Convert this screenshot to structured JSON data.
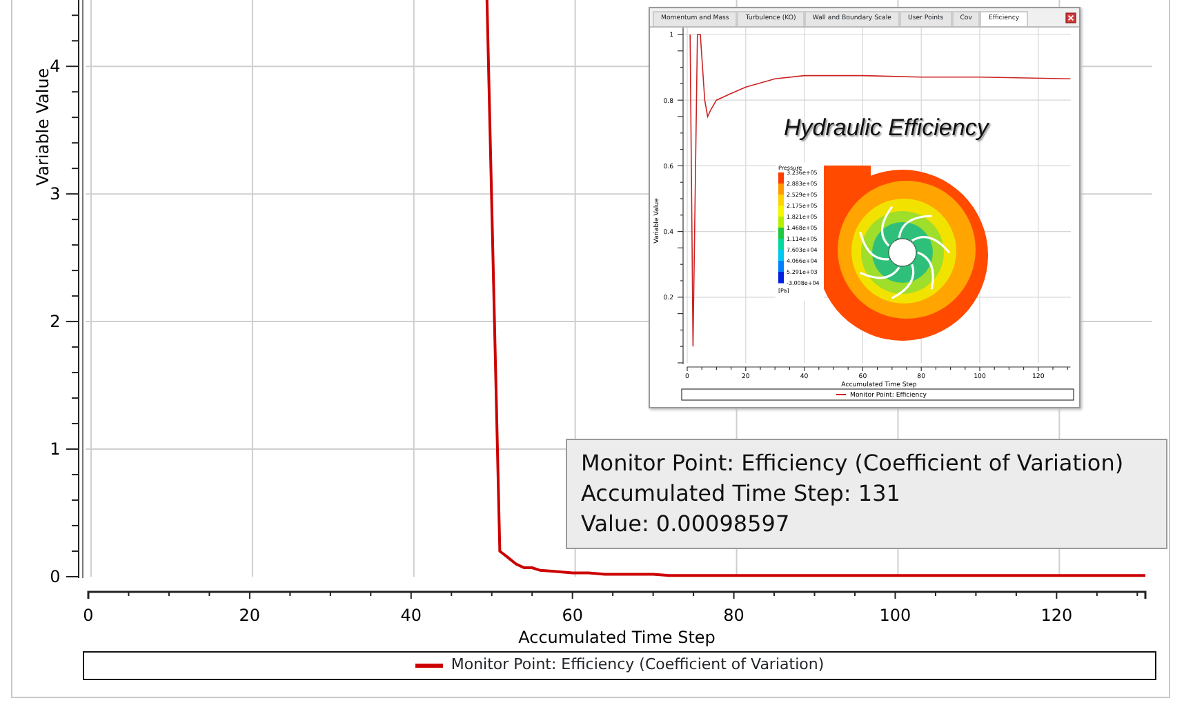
{
  "chart": {
    "chart_data": {
      "type": "line",
      "grid": true,
      "xlabel": "Accumulated Time Step",
      "ylabel": "Variable Value",
      "xlim": [
        0,
        131
      ],
      "ylim": [
        0,
        4.52
      ],
      "xticks": [
        0,
        20,
        40,
        60,
        80,
        100,
        120
      ],
      "yticks": [
        0,
        1,
        2,
        3,
        4
      ],
      "x": [
        49.4,
        51,
        52,
        53,
        54,
        55,
        56,
        58,
        60,
        62,
        64,
        70,
        72,
        131
      ],
      "series": [
        {
          "name": "Monitor Point: Efficiency (Coefficient of Variation)",
          "color": "#cc0000",
          "values": [
            4.52,
            0.2,
            0.15,
            0.1,
            0.07,
            0.07,
            0.05,
            0.04,
            0.03,
            0.03,
            0.02,
            0.02,
            0.01,
            0.01
          ]
        }
      ]
    }
  },
  "inset": {
    "tabs": [
      {
        "label": "Momentum and Mass",
        "selected": false
      },
      {
        "label": "Turbulence (KO)",
        "selected": false
      },
      {
        "label": "Wall and Boundary Scale",
        "selected": false
      },
      {
        "label": "User Points",
        "selected": false
      },
      {
        "label": "Cov",
        "selected": false
      },
      {
        "label": "Efficiency",
        "selected": true
      }
    ],
    "chart_data": {
      "type": "line",
      "grid": true,
      "xlabel": "Accumulated Time Step",
      "ylabel": "Variable Value",
      "xlim": [
        0,
        131
      ],
      "ylim": [
        0,
        1
      ],
      "xticks": [
        0,
        20,
        40,
        60,
        80,
        100,
        120
      ],
      "yticks": [
        {
          "value": 0.2,
          "label": "0.2"
        },
        {
          "value": 0.4,
          "label": "0.4"
        },
        {
          "value": 0.6,
          "label": "0.6"
        },
        {
          "value": 0.8,
          "label": "0.8"
        },
        {
          "value": 1,
          "label": "1"
        }
      ],
      "x": [
        1,
        2,
        3.5,
        4.5,
        6,
        7,
        8,
        10,
        15,
        20,
        30,
        40,
        60,
        80,
        100,
        131
      ],
      "series": [
        {
          "name": "Monitor Point: Efficiency",
          "color": "#cc2222",
          "values": [
            1,
            0.05,
            1,
            1,
            0.8,
            0.75,
            0.77,
            0.8,
            0.82,
            0.84,
            0.865,
            0.875,
            0.875,
            0.87,
            0.87,
            0.865
          ]
        }
      ]
    },
    "overlay_title": "Hydraulic Efficiency",
    "contour_legend": {
      "title": "Pressure",
      "values": [
        "3.236e+05",
        "2.883e+05",
        "2.529e+05",
        "2.175e+05",
        "1.821e+05",
        "1.468e+05",
        "1.114e+05",
        "7.603e+04",
        "4.066e+04",
        "5.291e+03",
        "-3.008e+04"
      ],
      "unit": "[Pa]"
    }
  },
  "tooltip": {
    "lines": [
      "Monitor Point: Efficiency (Coefficient of Variation)",
      "Accumulated Time Step: 131",
      "Value: 0.00098597"
    ]
  }
}
